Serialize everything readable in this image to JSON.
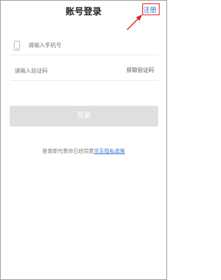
{
  "header": {
    "title": "账号登录",
    "register_label": "注册"
  },
  "form": {
    "phone_placeholder": "请输入手机号",
    "code_placeholder": "请输入验证码",
    "get_code_label": "获取验证码",
    "login_label": "登录"
  },
  "agreement": {
    "prefix": "登录即代表你已经同意",
    "link_label": "京东隐私政策"
  },
  "icons": {
    "phone": "phone-icon"
  },
  "colors": {
    "link": "#3a7bd5",
    "annotation": "#e02020",
    "button_disabled": "#e1dfdd"
  }
}
